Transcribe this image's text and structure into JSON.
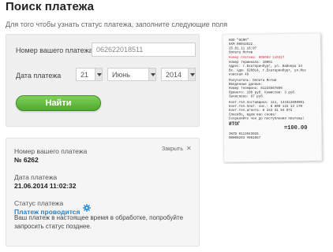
{
  "header": {
    "title": "Поиск платежа",
    "subtitle": "Для того чтобы узнать статус платежа, заполните следующие поля"
  },
  "search": {
    "number_label": "Номер вашего платежа",
    "number_value": "062622018511",
    "date_label": "Дата платежа",
    "day": "21",
    "month": "Июнь",
    "year": "2014",
    "button_label": "Найти"
  },
  "result": {
    "close_label": "Закрыть",
    "number_label": "Номер вашего платежа",
    "number_value": "№ 6262",
    "date_label": "Дата платежа",
    "date_value": "21.06.2014 11:02:32",
    "status_label": "Статус платежа",
    "status_value": "Платеж проводится",
    "note": "Ваш платеж в настоящее время в обработке, попробуйте запросить статус позднее."
  },
  "receipt": {
    "header_lines": [
      "ООО \"ОСМП\"",
      "ККМ 00043522",
      "25.01.11 16:07",
      "Оплата Мотив"
    ],
    "highlight": "Номер платежа: 000003 110317",
    "body_lines": [
      "Номер терминала: 10001",
      "Адрес: г.Екатеринбург, ул. Вайнера 34",
      "Вх. Адм: 620014, г.Екатеринбург, ул.Мос",
      "ковская 49",
      "",
      "Получатель: Оплата Мотив",
      "Введенные данные:",
      "Номер телефона: 81234567890",
      "Принято: 100 руб. Комиссия: 3 руб.",
      "Зачислено: 97 руб.",
      "",
      "Конт.тел.поставщика: 111, 134312690001",
      "Конт.тел.плат. сис.: 8 800 133 13 170",
      "Конт.тел.агента: 8 343 31 94 072",
      "Спасибо, ждем вас снова!",
      "Сохраняйте чек до поступления платежа!"
    ],
    "total_label": "ИТОГ",
    "total_value": "=100.00",
    "footer_lines": [
      "ЭКЛЗ 0113943026",
      "00000293 #061057"
    ]
  }
}
